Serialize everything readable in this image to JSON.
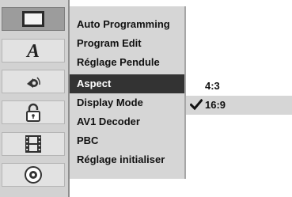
{
  "sidebar": {
    "icons": [
      {
        "name": "tv-screen-icon",
        "active": true
      },
      {
        "name": "language-letter-a-icon",
        "active": false
      },
      {
        "name": "audio-speaker-icon",
        "active": false
      },
      {
        "name": "padlock-icon",
        "active": false
      },
      {
        "name": "film-strip-icon",
        "active": false
      },
      {
        "name": "disc-icon",
        "active": false
      }
    ]
  },
  "menu": {
    "items": [
      {
        "label": "Auto Programming"
      },
      {
        "label": "Program Edit"
      },
      {
        "label": "Réglage Pendule"
      },
      {
        "label": "Aspect"
      },
      {
        "label": "Display Mode"
      },
      {
        "label": "AV1 Decoder"
      },
      {
        "label": "PBC"
      },
      {
        "label": "Réglage initialiser"
      }
    ],
    "selected": "Aspect"
  },
  "options": {
    "items": [
      {
        "label": "4:3"
      },
      {
        "label": "16:9"
      }
    ],
    "selected": "16:9"
  }
}
